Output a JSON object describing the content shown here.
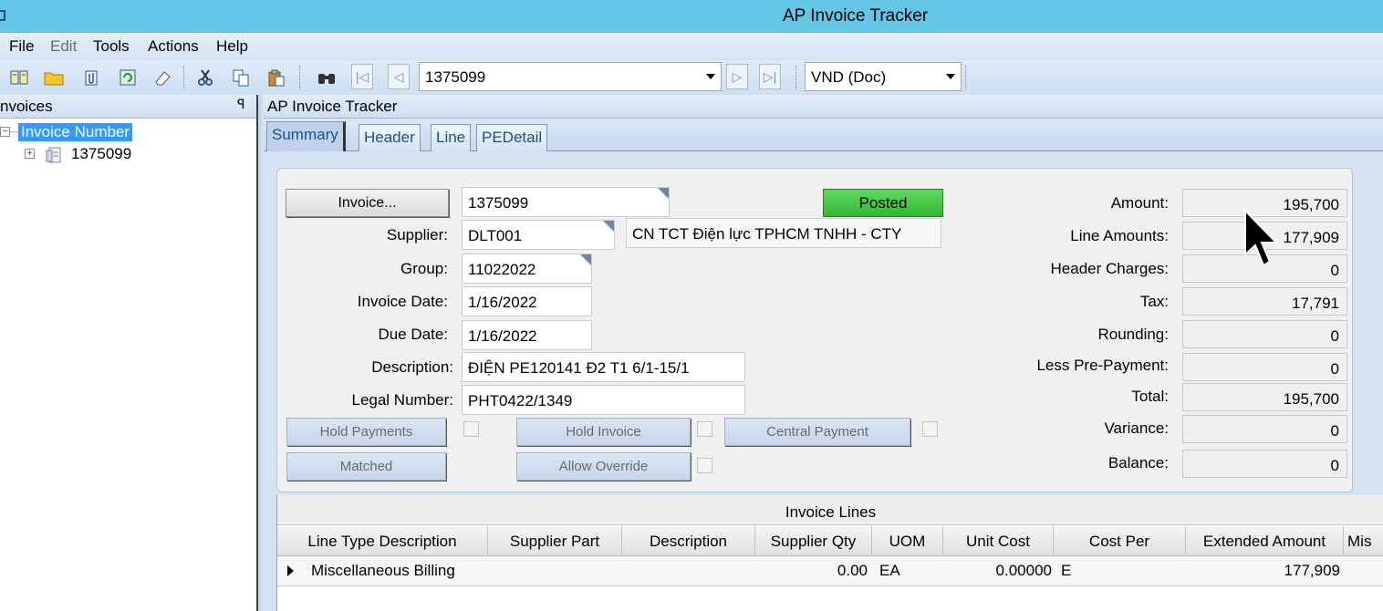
{
  "window": {
    "title": "AP Invoice Tracker"
  },
  "menu": {
    "file": "File",
    "edit": "Edit",
    "tools": "Tools",
    "actions": "Actions",
    "help": "Help"
  },
  "toolbar": {
    "invoice_combo": "1375099",
    "currency_combo": "VND (Doc)"
  },
  "left_panel": {
    "title": "nvoices",
    "tree_root": "Invoice Number",
    "tree_child": "1375099"
  },
  "right_panel": {
    "title": "AP Invoice Tracker"
  },
  "tabs": [
    {
      "label": "Summary",
      "active": true
    },
    {
      "label": "Header"
    },
    {
      "label": "Line"
    },
    {
      "label": "PEDetail"
    }
  ],
  "summary": {
    "invoice_button": "Invoice...",
    "invoice_value": "1375099",
    "status": "Posted",
    "supplier_label": "Supplier:",
    "supplier_value": "DLT001",
    "supplier_name": "CN TCT Điện lực TPHCM TNHH - CTY",
    "group_label": "Group:",
    "group_value": "11022022",
    "invoice_date_label": "Invoice Date:",
    "invoice_date_value": "1/16/2022",
    "due_date_label": "Due Date:",
    "due_date_value": "1/16/2022",
    "description_label": "Description:",
    "description_value": "ĐIỆN PE120141 Đ2 T1 6/1-15/1",
    "legal_number_label": "Legal Number:",
    "legal_number_value": "PHT0422/1349",
    "hold_payments": "Hold Payments",
    "hold_invoice": "Hold Invoice",
    "central_payment": "Central Payment",
    "matched": "Matched",
    "allow_override": "Allow Override",
    "totals": [
      {
        "label": "Amount:",
        "value": "195,700"
      },
      {
        "label": "Line Amounts:",
        "value": "177,909"
      },
      {
        "label": "Header Charges:",
        "value": "0"
      },
      {
        "label": "Tax:",
        "value": "17,791"
      },
      {
        "label": "Rounding:",
        "value": "0"
      },
      {
        "label": "Less Pre-Payment:",
        "value": "0"
      },
      {
        "label": "Total:",
        "value": "195,700"
      },
      {
        "label": "Variance:",
        "value": "0"
      },
      {
        "label": "Balance:",
        "value": "0"
      }
    ]
  },
  "grid": {
    "caption": "Invoice Lines",
    "columns": [
      "Line Type Description",
      "Supplier Part",
      "Description",
      "Supplier Qty",
      "UOM",
      "Unit Cost",
      "Cost Per",
      "Extended Amount",
      "Mis"
    ],
    "rows": [
      {
        "line_type": "Miscellaneous Billing",
        "supplier_part": "",
        "description": "",
        "qty": "0.00",
        "uom": "EA",
        "unit_cost": "0.00000",
        "cost_per": "E",
        "extended": "177,909",
        "misc": ""
      }
    ]
  },
  "colors": {
    "title_bar": "#63c6e7",
    "posted": "#4ccb4c",
    "selection": "#3399ff"
  },
  "icons": [
    "app-icon",
    "open-book-icon",
    "folder-icon",
    "attach-icon",
    "refresh-icon",
    "eraser-icon",
    "cut-icon",
    "copy-icon",
    "paste-icon",
    "binoculars-icon",
    "first-record-icon",
    "previous-record-icon",
    "next-record-icon",
    "last-record-icon",
    "pin-icon",
    "document-icon",
    "mouse-pointer-icon"
  ]
}
